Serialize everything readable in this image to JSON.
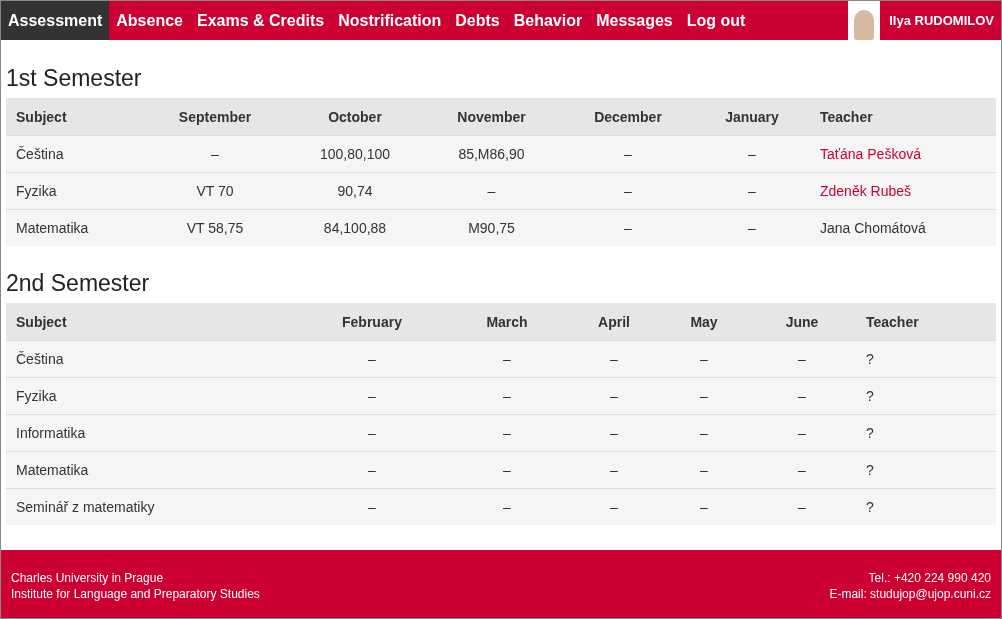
{
  "nav": {
    "tabs": [
      {
        "label": "Assessment",
        "selected": true
      },
      {
        "label": "Absence",
        "selected": false
      },
      {
        "label": "Exams & Credits",
        "selected": false
      },
      {
        "label": "Nostrification",
        "selected": false
      },
      {
        "label": "Debts",
        "selected": false
      },
      {
        "label": "Behavior",
        "selected": false
      },
      {
        "label": "Messages",
        "selected": false
      },
      {
        "label": "Log out",
        "selected": false
      }
    ],
    "user": {
      "name": "Ilya RUDOMILOV"
    }
  },
  "semesters": [
    {
      "title": "1st Semester",
      "columns": [
        "Subject",
        "September",
        "October",
        "November",
        "December",
        "January",
        "Teacher"
      ],
      "rows": [
        {
          "cells": [
            "Čeština",
            "–",
            "100,80,100",
            "85,M86,90",
            "–",
            "–"
          ],
          "teacher": {
            "name": "Taťána Pešková",
            "kind": "link"
          }
        },
        {
          "cells": [
            "Fyzika",
            "VT 70",
            "90,74",
            "–",
            "–",
            "–"
          ],
          "teacher": {
            "name": "Zdeněk Rubeš",
            "kind": "link"
          }
        },
        {
          "cells": [
            "Matematika",
            "VT 58,75",
            "84,100,88",
            "M90,75",
            "–",
            "–"
          ],
          "teacher": {
            "name": "Jana Chomátová",
            "kind": "plain"
          }
        }
      ]
    },
    {
      "title": "2nd Semester",
      "columns": [
        "Subject",
        "February",
        "March",
        "April",
        "May",
        "June",
        "Teacher"
      ],
      "rows": [
        {
          "cells": [
            "Čeština",
            "–",
            "–",
            "–",
            "–",
            "–"
          ],
          "teacher": {
            "name": "?",
            "kind": "plain"
          }
        },
        {
          "cells": [
            "Fyzika",
            "–",
            "–",
            "–",
            "–",
            "–"
          ],
          "teacher": {
            "name": "?",
            "kind": "plain"
          }
        },
        {
          "cells": [
            "Informatika",
            "–",
            "–",
            "–",
            "–",
            "–"
          ],
          "teacher": {
            "name": "?",
            "kind": "plain"
          }
        },
        {
          "cells": [
            "Matematika",
            "–",
            "–",
            "–",
            "–",
            "–"
          ],
          "teacher": {
            "name": "?",
            "kind": "plain"
          }
        },
        {
          "cells": [
            "Seminář z matematiky",
            "–",
            "–",
            "–",
            "–",
            "–"
          ],
          "teacher": {
            "name": "?",
            "kind": "plain"
          }
        }
      ]
    }
  ],
  "footer": {
    "left": [
      "Charles University in Prague",
      "Institute for Language and Preparatory Studies"
    ],
    "right": [
      "Tel.: +420 224 990 420",
      "E-mail: studujop@ujop.cuni.cz"
    ]
  }
}
